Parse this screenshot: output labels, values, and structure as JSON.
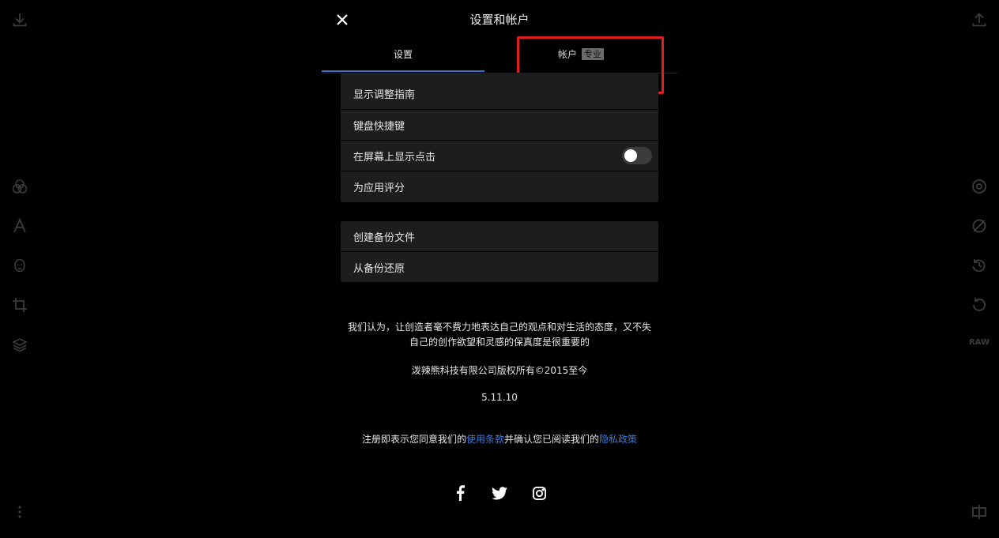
{
  "dialog": {
    "title": "设置和帐户"
  },
  "tabs": {
    "settings_label": "设置",
    "account_label": "帐户",
    "pro_badge": "专业"
  },
  "settings_group": {
    "items": [
      {
        "label": "显示调整指南"
      },
      {
        "label": "键盘快捷键"
      },
      {
        "label": "在屏幕上显示点击",
        "toggle": "off"
      },
      {
        "label": "为应用评分"
      }
    ]
  },
  "backup_group": {
    "items": [
      {
        "label": "创建备份文件"
      },
      {
        "label": "从备份还原"
      }
    ]
  },
  "about": {
    "statement": "我们认为，让创造者毫不费力地表达自己的观点和对生活的态度，又不失自己的创作欲望和灵感的保真度是很重要的",
    "copyright": "泼辣熊科技有限公司版权所有©2015至今",
    "version": "5.11.10"
  },
  "legal": {
    "prefix": "注册即表示您同意我们的",
    "terms_link": "使用条款",
    "middle": "并确认您已阅读我们的",
    "privacy_link": "隐私政策"
  },
  "sidebar_right": {
    "raw_label": "RAW"
  },
  "social": [
    "facebook-icon",
    "twitter-icon",
    "instagram-icon"
  ],
  "colors": {
    "background": "#000000",
    "panel": "#1d1d1d",
    "accent": "#2e6dcc",
    "link": "#3d7bd9",
    "highlight_box": "#e01e1e"
  }
}
